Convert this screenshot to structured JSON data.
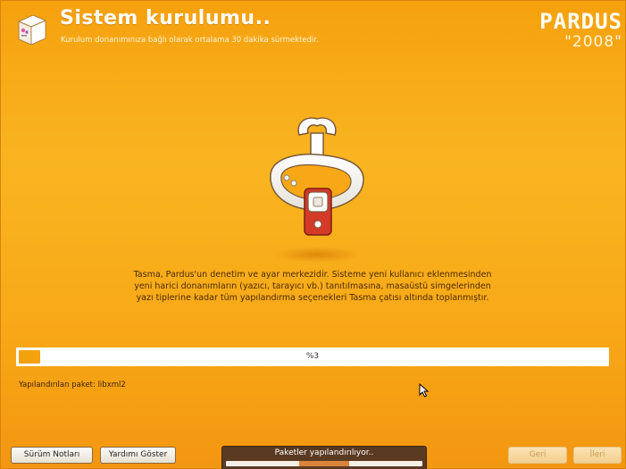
{
  "header": {
    "title": "Sistem kurulumu..",
    "subtitle": "Kurulum donanımınıza bağlı olarak ortalama 30 dakika sürmektedir.",
    "app_icon": "pardus-installer-icon",
    "brand_name": "PARDUS",
    "brand_year": "\"2008\""
  },
  "main": {
    "illustration_icon": "tasma-wrench-collar-icon",
    "description": "Tasma, Pardus'un denetim ve ayar merkezidir. Sisteme yeni kullanıcı eklenmesinden yeni harici donanımların (yazıcı, tarayıcı vb.) tanıtılmasına, masaüstü simgelerinden yazı tiplerine kadar tüm yapılandırma seçenekleri Tasma çatısı altında toplanmıştır."
  },
  "progress": {
    "label": "%3",
    "fraction": 0.03,
    "fill_color": "#f2a20d"
  },
  "status": {
    "configuring": "Yapılandırılan paket: libxml2"
  },
  "footer": {
    "release_notes_label": "Sürüm Notları",
    "show_help_label": "Yardımı Göster",
    "status_panel_label": "Paketler yapılandırılıyor..",
    "back_label": "Geri",
    "next_label": "İleri"
  },
  "colors": {
    "background": "#f8a817",
    "accent": "#f2a20d",
    "status_panel": "#5b3a22"
  }
}
